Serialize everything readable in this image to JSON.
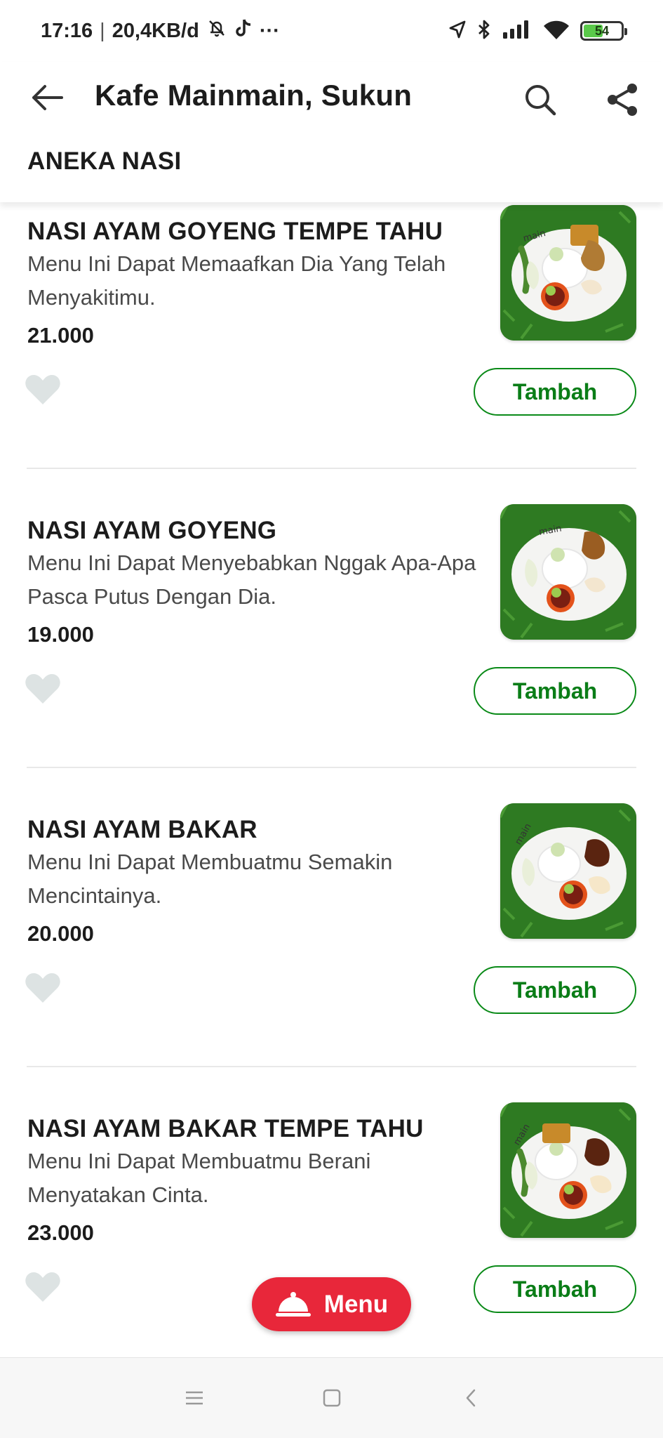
{
  "status_bar": {
    "time": "17:16",
    "network_speed": "20,4KB/d",
    "more": "···",
    "battery": "54",
    "battery_percent": 54
  },
  "header": {
    "title": "Kafe Mainmain, Sukun",
    "category": "ANEKA NASI",
    "back_icon": "arrow-left-icon",
    "search_icon": "search-icon",
    "share_icon": "share-icon"
  },
  "items": [
    {
      "name": "NASI AYAM GOYENG TEMPE TAHU",
      "description": "Menu Ini Dapat Memaafkan Dia Yang Telah Menyakitimu.",
      "price": "21.000",
      "add_label": "Tambah",
      "image_label": "main"
    },
    {
      "name": "NASI AYAM GOYENG",
      "description": "Menu Ini Dapat Menyebabkan Nggak Apa-Apa Pasca Putus Dengan Dia.",
      "price": "19.000",
      "add_label": "Tambah",
      "image_label": "main"
    },
    {
      "name": "NASI AYAM BAKAR",
      "description": "Menu Ini Dapat Membuatmu Semakin Mencintainya.",
      "price": "20.000",
      "add_label": "Tambah",
      "image_label": "main"
    },
    {
      "name": "NASI AYAM BAKAR TEMPE TAHU",
      "description": "Menu Ini Dapat Membuatmu Berani Menyatakan Cinta.",
      "price": "23.000",
      "add_label": "Tambah",
      "image_label": "main"
    }
  ],
  "fab": {
    "label": "Menu",
    "icon": "cloche-icon"
  },
  "colors": {
    "accent_green": "#0a8a18",
    "fab_red": "#e8273a",
    "heart_grey": "#dde3e3"
  }
}
